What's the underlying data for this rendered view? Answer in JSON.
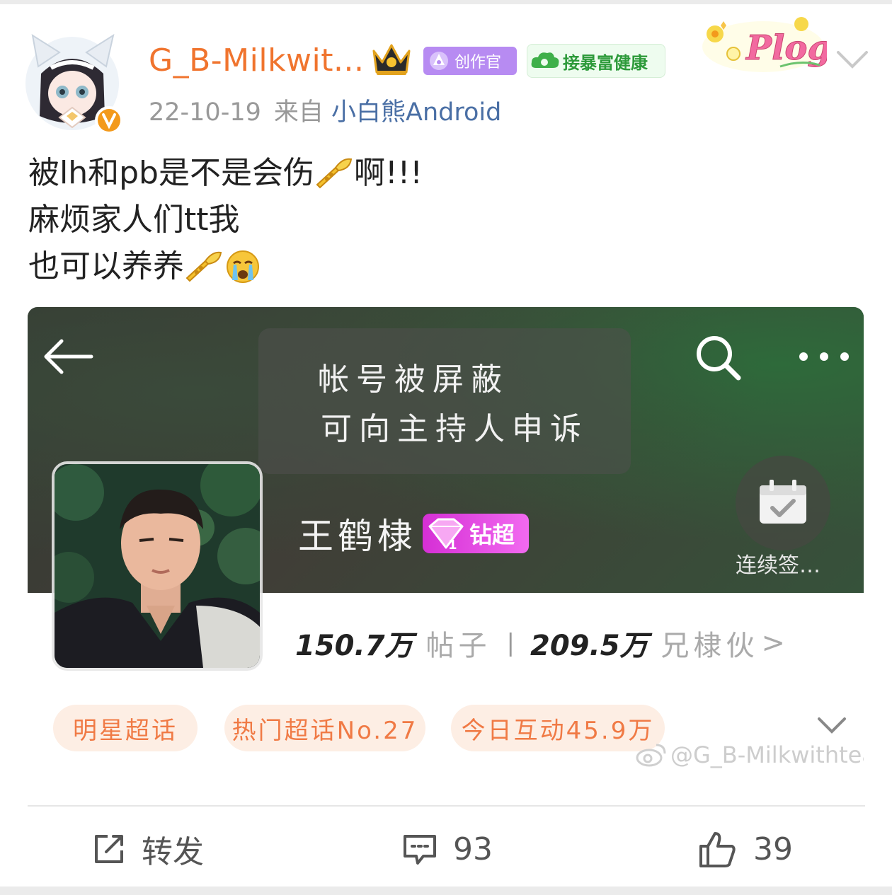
{
  "post": {
    "username": "G_B-Milkwit...",
    "badges": {
      "creator": "创作官",
      "health": "接暴富健康"
    },
    "decoration": "Plog",
    "date": "22-10-19",
    "source_prefix": "来自",
    "source_app": "小白熊Android",
    "text_lines": [
      {
        "text": "被lh和pb是不是会伤",
        "emoji": "trumpet",
        "suffix": "啊!!!"
      },
      {
        "text": "麻烦家人们tt我"
      },
      {
        "text": "也可以养养",
        "emoji": "trumpet",
        "emoji2": "crying-face"
      }
    ]
  },
  "card": {
    "blocked_line1": "帐号被屏蔽",
    "blocked_line2": "可向主持人申诉",
    "name": "王鹤棣",
    "tier_badge": "钻超",
    "tier_level": "1",
    "sign_label": "连续签…",
    "stats": {
      "posts_count": "150.7万",
      "posts_label": "帖子",
      "separator": "|",
      "fans_count": "209.5万",
      "fans_label": "兄棣伙",
      "chevron": ">"
    },
    "tags": [
      "明星超话",
      "热门超话No.27",
      "今日互动45.9万"
    ],
    "watermark": "@G_B-Milkwithtea"
  },
  "actions": {
    "repost_label": "转发",
    "comment_count": "93",
    "like_count": "39"
  },
  "colors": {
    "username": "#f0742e",
    "source_link": "#4a6fa5",
    "tag_bg": "#fdeee4",
    "tag_text": "#f07a45",
    "diamond_badge": "#e04ae0"
  }
}
